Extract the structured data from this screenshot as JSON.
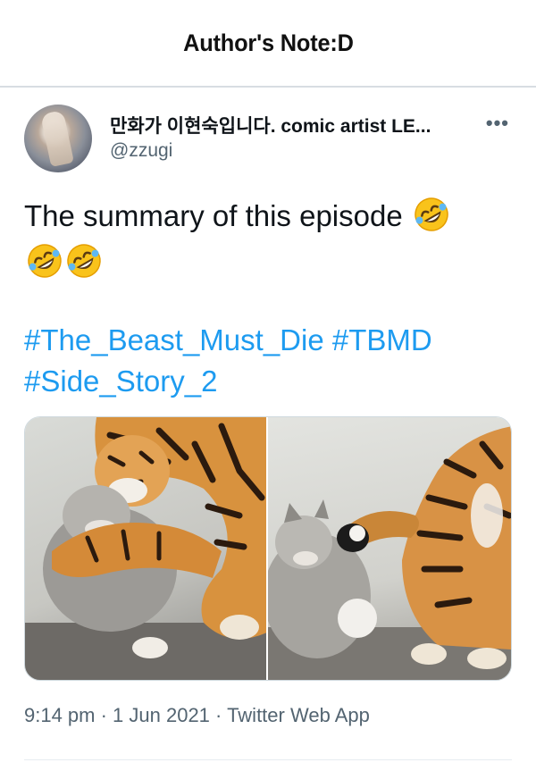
{
  "header": {
    "title": "Author's Note:D"
  },
  "tweet": {
    "display_name": "만화가 이현숙입니다. comic artist LE...",
    "handle": "@zzugi",
    "more_label": "•••",
    "text": "The summary of this episode",
    "emoji_name": "rolling-on-floor-laughing-emoji",
    "hashtags": [
      "#The_Beast_Must_Die",
      "#TBMD",
      "#Side_Story_2"
    ],
    "timestamp": "9:14 pm · 1 Jun 2021 · Twitter Web App",
    "link_color": "#1d9bf0"
  }
}
